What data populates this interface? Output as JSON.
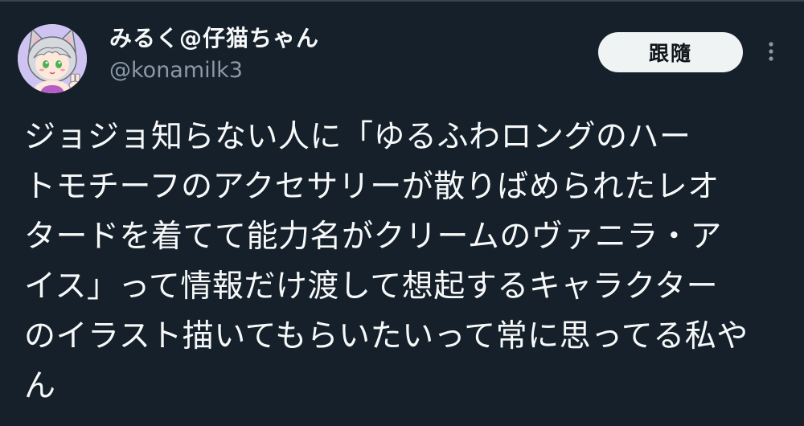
{
  "tweet": {
    "author": {
      "display_name": "みるく@仔猫ちゃん",
      "handle": "@konamilk3",
      "avatar_icon": "avatar-cat-girl"
    },
    "follow_label": "跟隨",
    "more_icon": "more-dots-icon",
    "text_lines": [
      "ジョジョ知らない人に「ゆるふわロングのハー",
      "トモチーフのアクセサリーが散りばめられたレオ",
      "タードを着てて能力名がクリームのヴァニラ・ア",
      "イス」って情報だけ渡して想起するキャラクター",
      "のイラスト描いてもらいたいって常に思ってる私や",
      "ん"
    ]
  },
  "colors": {
    "background": "#15202b",
    "text_primary": "#f7f9f9",
    "text_secondary": "#8b98a5",
    "button_bg": "#eff3f4",
    "button_text": "#0f1419"
  }
}
